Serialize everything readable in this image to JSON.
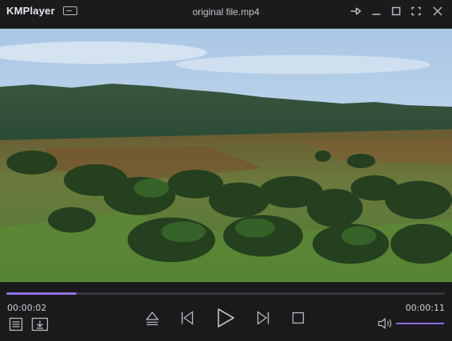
{
  "titlebar": {
    "app_name": "KMPlayer",
    "file_title": "original file.mp4"
  },
  "icons": {
    "menu": "menu-toggle-icon",
    "pin": "pin-icon",
    "minimize": "minimize-icon",
    "maximize": "maximize-icon",
    "fullscreen": "fullscreen-icon",
    "close": "close-icon",
    "playlist": "playlist-icon",
    "download": "download-icon",
    "eject": "eject-icon",
    "previous": "previous-icon",
    "play": "play-icon",
    "next": "next-icon",
    "stop": "stop-icon",
    "volume": "volume-icon"
  },
  "playback": {
    "elapsed": "00:00:02",
    "total": "00:00:11",
    "progress_fraction": 0.16,
    "volume_fraction": 1.0
  },
  "colors": {
    "accent": "#8f6fe0",
    "background": "#1a1a1d",
    "icon": "#b9b9be"
  }
}
